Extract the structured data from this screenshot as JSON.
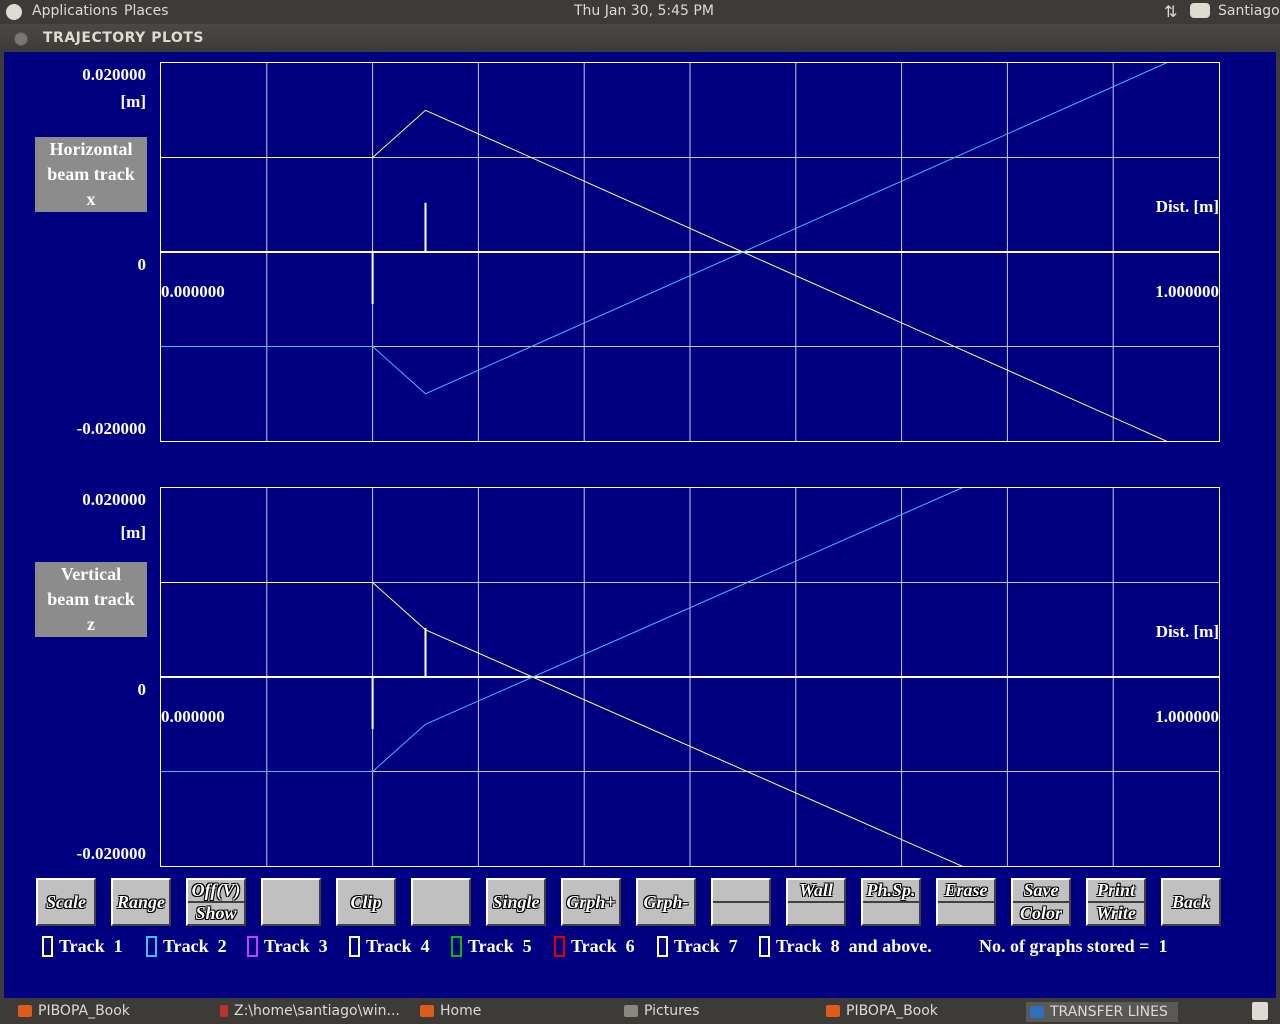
{
  "topbar": {
    "menu_applications": "Applications",
    "menu_places": "Places",
    "clock": "Thu Jan 30,  5:45 PM",
    "user": "Santiago"
  },
  "window": {
    "title": "TRAJECTORY PLOTS"
  },
  "colors": {
    "background": "#000080",
    "track1": "#ffff80",
    "track2": "#40c0ff",
    "track3": "#c040ff",
    "track4": "#ffffff",
    "track5": "#00c000",
    "track6": "#e00000",
    "track7": "#ffffff",
    "track8": "#ffffff"
  },
  "plots": {
    "horizontal": {
      "ymax_label": "0.020000",
      "unit": "[m]",
      "zero_label": "0",
      "ymin_label": "-0.020000",
      "panel_lines": [
        "Horizontal",
        "beam track",
        "x"
      ],
      "dist_label": "Dist. [m]",
      "xmin_label": "0.000000",
      "xmax_label": "1.000000"
    },
    "vertical": {
      "ymax_label": "0.020000",
      "unit": "[m]",
      "zero_label": "0",
      "ymin_label": "-0.020000",
      "panel_lines": [
        "Vertical",
        "beam track",
        "z"
      ],
      "dist_label": "Dist. [m]",
      "xmin_label": "0.000000",
      "xmax_label": "1.000000"
    }
  },
  "chart_data": [
    {
      "type": "line",
      "title": "Horizontal beam track x",
      "xlabel": "Dist. [m]",
      "ylabel": "[m]",
      "xlim": [
        0,
        1
      ],
      "ylim": [
        -0.02,
        0.02
      ],
      "grid": true,
      "series": [
        {
          "name": "Track 1",
          "x": [
            0,
            0.2,
            0.25,
            1.0
          ],
          "y": [
            0.01,
            0.01,
            0.015,
            -0.0225
          ]
        },
        {
          "name": "Track 2",
          "x": [
            0,
            0.2,
            0.25,
            1.0
          ],
          "y": [
            -0.01,
            -0.01,
            -0.015,
            0.0225
          ]
        }
      ],
      "markers": [
        {
          "x": 0.2,
          "y1": 0,
          "y2": -0.0055
        },
        {
          "x": 0.25,
          "y1": 0,
          "y2": 0.0052
        }
      ]
    },
    {
      "type": "line",
      "title": "Vertical beam track z",
      "xlabel": "Dist. [m]",
      "ylabel": "[m]",
      "xlim": [
        0,
        1
      ],
      "ylim": [
        -0.02,
        0.02
      ],
      "grid": true,
      "series": [
        {
          "name": "Track 1",
          "x": [
            0,
            0.2,
            0.25,
            1.0
          ],
          "y": [
            0.01,
            0.01,
            0.005,
            -0.032
          ]
        },
        {
          "name": "Track 2",
          "x": [
            0,
            0.2,
            0.25,
            1.0
          ],
          "y": [
            -0.01,
            -0.01,
            -0.005,
            0.032
          ]
        }
      ],
      "markers": [
        {
          "x": 0.2,
          "y1": 0,
          "y2": -0.0055
        },
        {
          "x": 0.25,
          "y1": 0,
          "y2": 0.0052
        }
      ]
    }
  ],
  "buttons": [
    {
      "id": "scale",
      "label": "Scale"
    },
    {
      "id": "range",
      "label": "Range"
    },
    {
      "id": "offv-show",
      "top": "Off(V)",
      "bottom": "Show"
    },
    {
      "id": "blank1",
      "label": ""
    },
    {
      "id": "clip",
      "label": "Clip"
    },
    {
      "id": "blank2",
      "label": ""
    },
    {
      "id": "single",
      "label": "Single"
    },
    {
      "id": "grph-plus",
      "label": "Grph+"
    },
    {
      "id": "grph-minus",
      "label": "Grph-"
    },
    {
      "id": "blank3",
      "top": "",
      "bottom": ""
    },
    {
      "id": "wall",
      "top": "Wall",
      "bottom": ""
    },
    {
      "id": "phsp",
      "top": "Ph.Sp.",
      "bottom": ""
    },
    {
      "id": "erase",
      "top": "Erase",
      "bottom": ""
    },
    {
      "id": "save-color",
      "top": "Save",
      "bottom": "Color"
    },
    {
      "id": "print-write",
      "top": "Print",
      "bottom": "Write"
    },
    {
      "id": "back",
      "label": "Back"
    }
  ],
  "tracks": [
    {
      "label": "Track",
      "num": "1"
    },
    {
      "label": "Track",
      "num": "2"
    },
    {
      "label": "Track",
      "num": "3"
    },
    {
      "label": "Track",
      "num": "4"
    },
    {
      "label": "Track",
      "num": "5"
    },
    {
      "label": "Track",
      "num": "6"
    },
    {
      "label": "Track",
      "num": "7"
    },
    {
      "label": "Track",
      "num": "8"
    }
  ],
  "tracks_suffix": "and above.",
  "graphs_stored_label": "No. of graphs stored =",
  "graphs_stored_value": "1",
  "taskbar": [
    {
      "label": "PIBOPA_Book"
    },
    {
      "label": "Z:\\home\\santiago\\win..."
    },
    {
      "label": "Home"
    },
    {
      "label": "Pictures"
    },
    {
      "label": "PIBOPA_Book"
    },
    {
      "label": "TRANSFER LINES"
    }
  ]
}
